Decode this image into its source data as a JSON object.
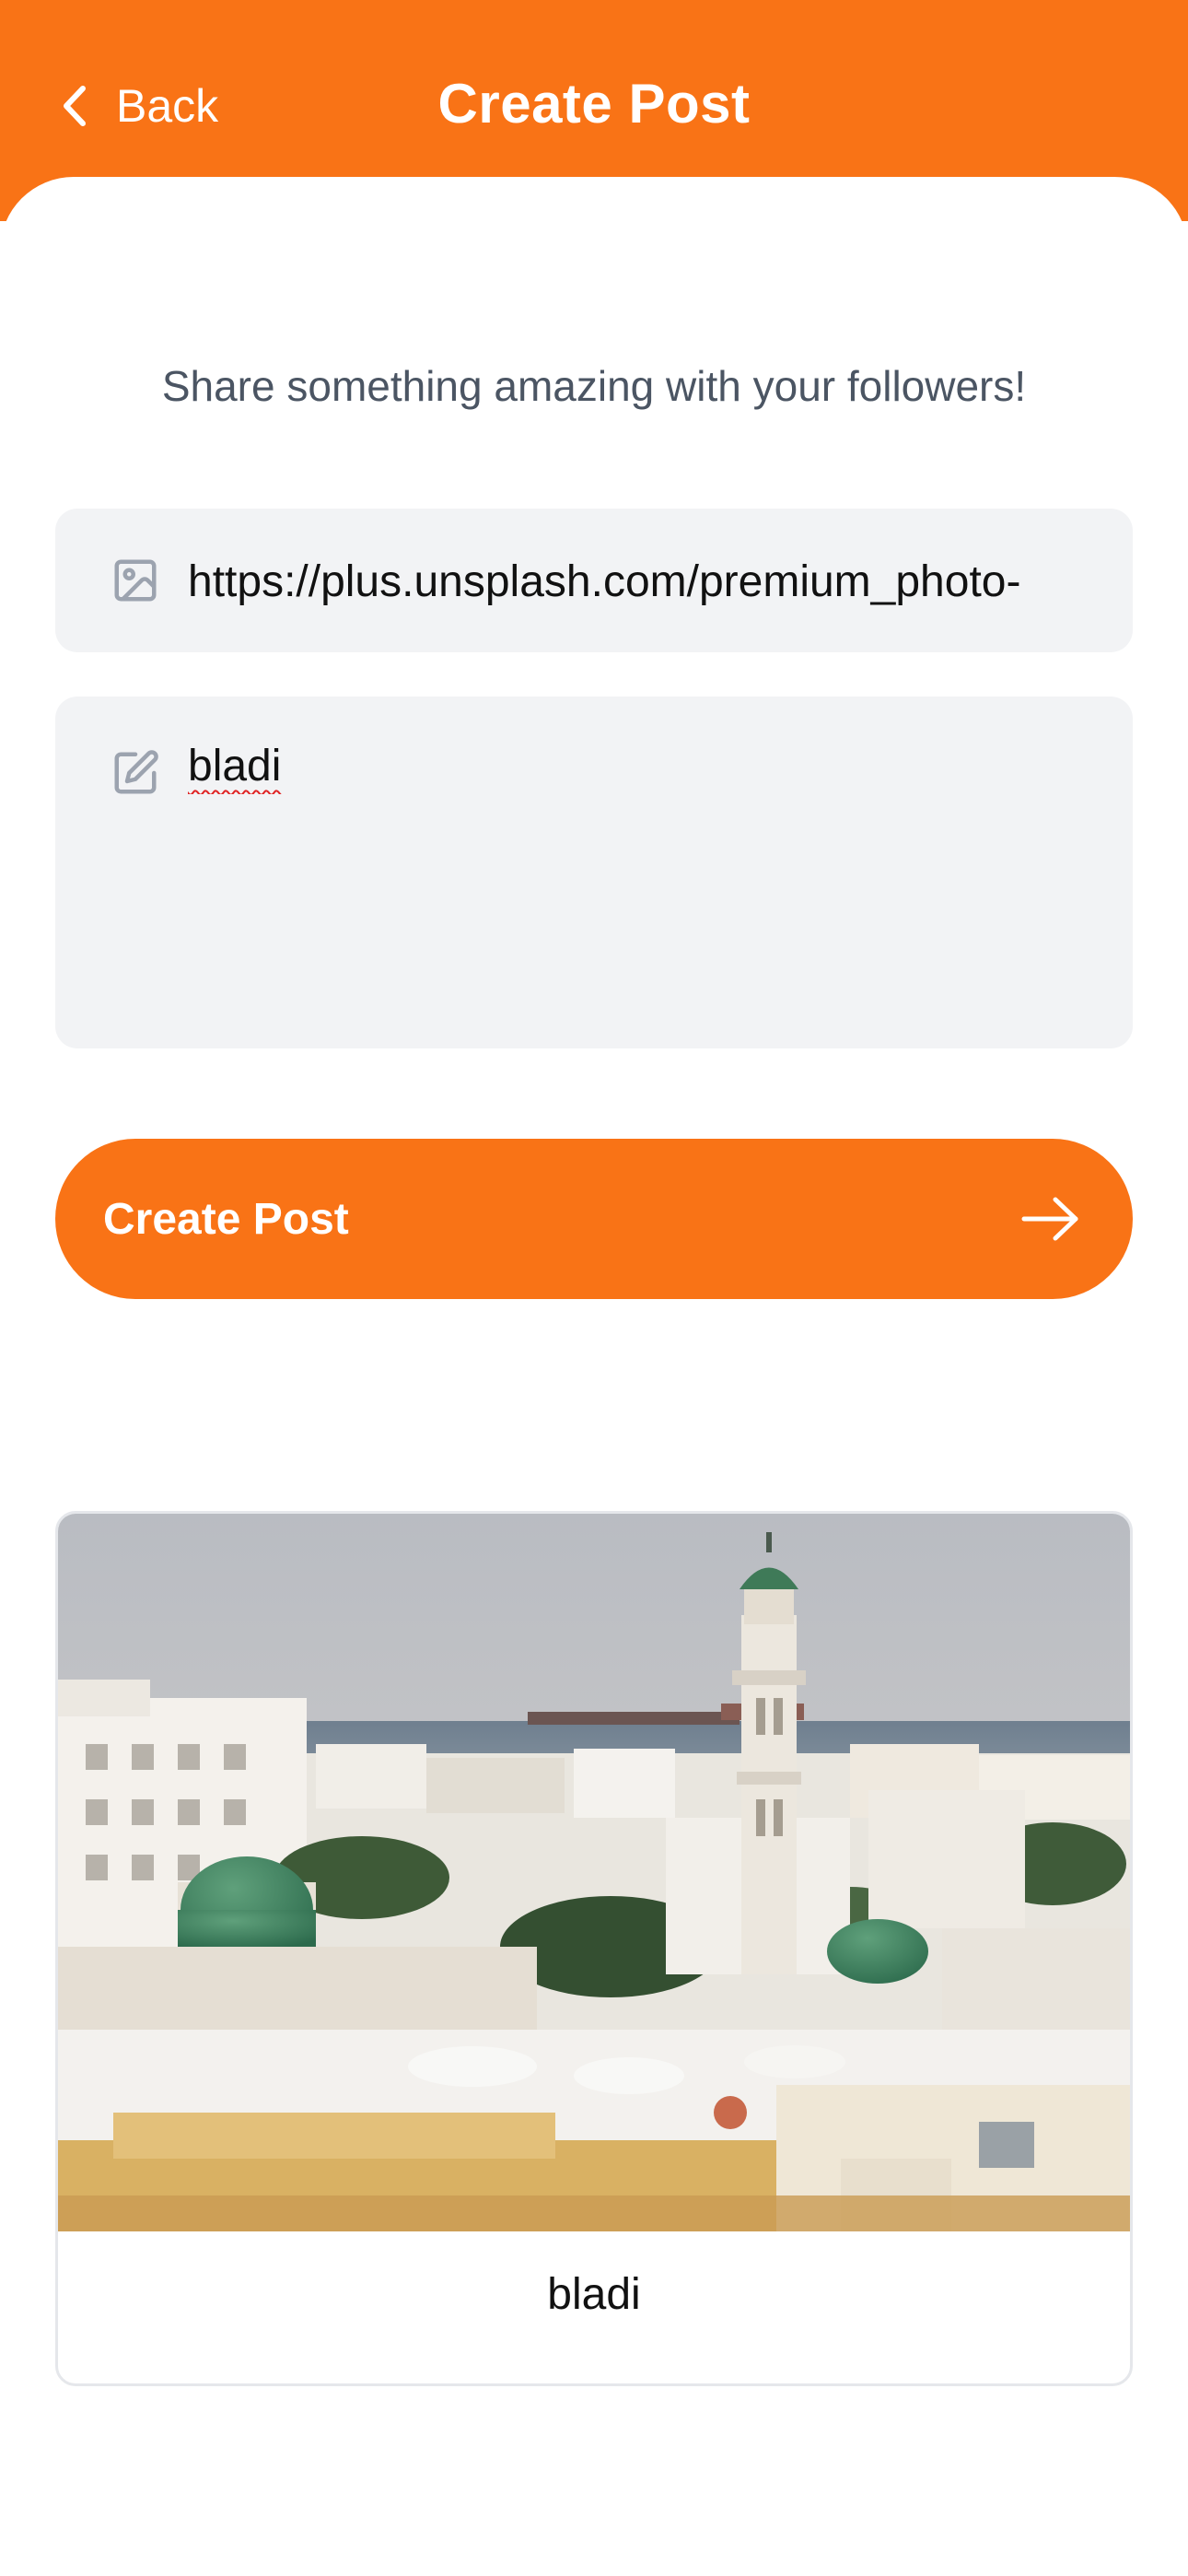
{
  "header": {
    "back_label": "Back",
    "title": "Create Post",
    "background_color": "#f97316"
  },
  "form": {
    "subtitle": "Share something amazing with your followers!",
    "image_url_value": "https://plus.unsplash.com/premium_photo-",
    "image_icon": "image-icon",
    "caption_value": "bladi",
    "caption_icon": "edit-icon",
    "submit_label": "Create Post",
    "submit_icon": "arrow-right-icon"
  },
  "preview": {
    "caption": "bladi",
    "image_description_icon": "photo"
  }
}
